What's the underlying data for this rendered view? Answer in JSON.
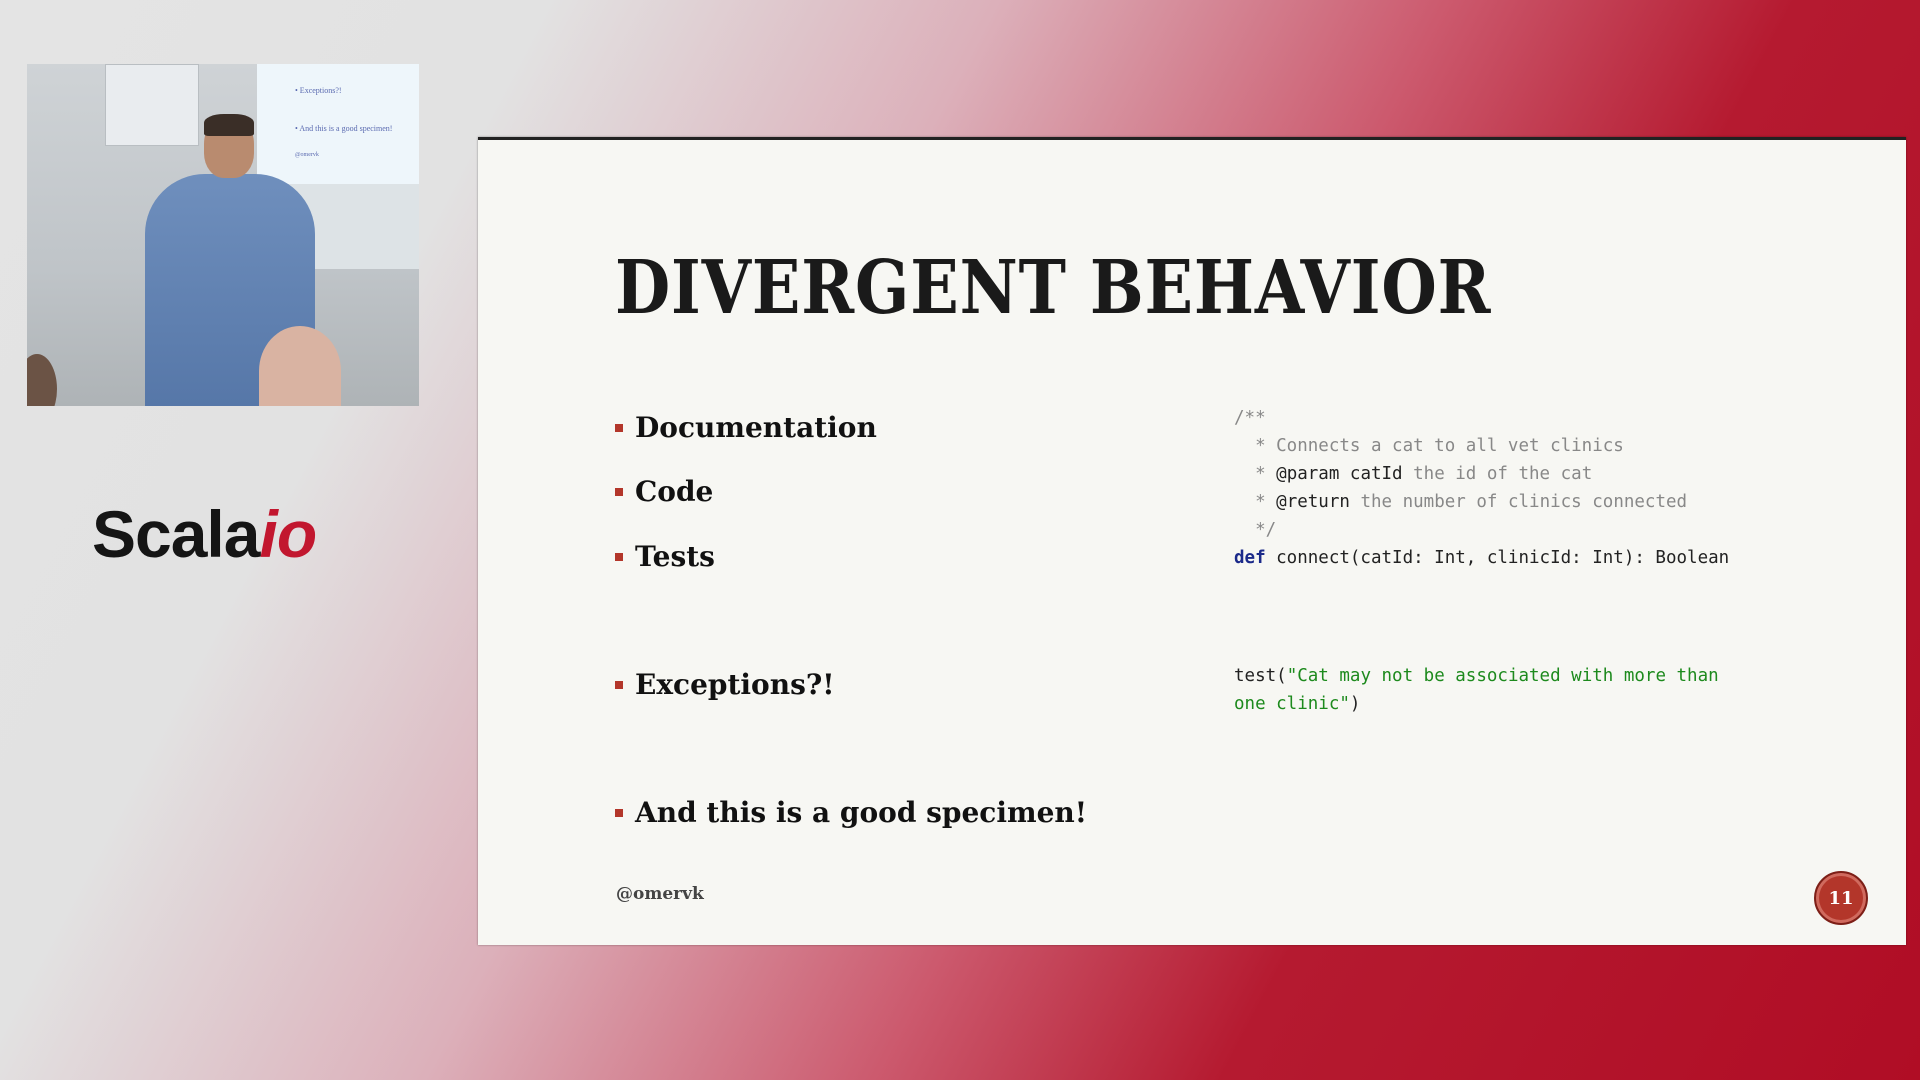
{
  "camera": {
    "projection_lines": [
      "• Exceptions?!",
      "• And this is a good specimen!",
      "@omervk"
    ]
  },
  "logo": {
    "text_main": "Scala",
    "text_accent": "io"
  },
  "slide": {
    "title": "Divergent Behavior",
    "bullets": [
      "Documentation",
      "Code",
      "Tests",
      "Exceptions?!",
      "And this is a good specimen!"
    ],
    "code_doc": {
      "l1": "/**",
      "l2": "  * Connects a cat to all vet clinics",
      "l3_prefix": "  * ",
      "l3_tag": "@param catId",
      "l3_rest": " the id of the cat",
      "l4_prefix": "  * ",
      "l4_tag": "@return",
      "l4_rest": " the number of clinics connected",
      "l5": "  */",
      "l6_kw": "def",
      "l6_rest": " connect(catId: Int, clinicId: Int): Boolean"
    },
    "code_test": {
      "fn": "test(",
      "str1": "\"Cat may not be associated with more than",
      "str2": "one clinic\"",
      "close": ")"
    },
    "handle": "@omervk",
    "page_number": "11"
  },
  "colors": {
    "accent": "#b3362a",
    "brand_red": "#c2172f",
    "keyword": "#1b2a8a",
    "string": "#1d8a1d"
  }
}
